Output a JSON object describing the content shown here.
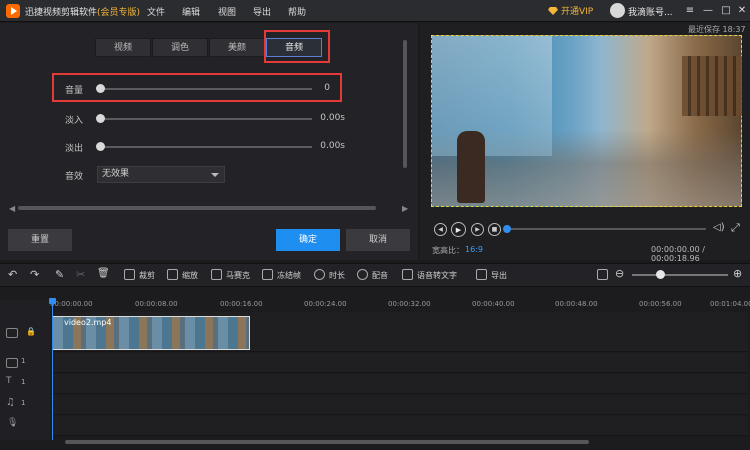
{
  "app": {
    "title": "迅捷视频剪辑软件",
    "edition": "(会员专版)"
  },
  "menu": [
    "文件",
    "编辑",
    "视图",
    "导出",
    "帮助"
  ],
  "account": {
    "vip_label": "开通VIP",
    "name": "我滴账号..."
  },
  "panel": {
    "tabs": [
      {
        "label": "视频",
        "active": false
      },
      {
        "label": "调色",
        "active": false
      },
      {
        "label": "美颜",
        "active": false
      },
      {
        "label": "音频",
        "active": true
      }
    ],
    "volume": {
      "label": "音量",
      "value": "0",
      "level": 0
    },
    "fade_in": {
      "label": "淡入",
      "value": "0.00s",
      "level": 0
    },
    "fade_out": {
      "label": "淡出",
      "value": "0.00s",
      "level": 0
    },
    "sound_effect": {
      "label": "音效",
      "value": "无效果"
    },
    "reset_label": "重置",
    "ok_label": "确定",
    "cancel_label": "取消"
  },
  "preview": {
    "autosave": "最近保存 18:37",
    "ratio_label": "宽高比：",
    "ratio_value": "16:9",
    "timecode": "00:00:00.00 / 00:00:18.96"
  },
  "toolbar": {
    "tools": [
      "裁剪",
      "缩放",
      "马赛克",
      "冻结帧",
      "时长",
      "配音",
      "语音转文字",
      "导出"
    ]
  },
  "timeline": {
    "ticks": [
      "00:00:00.00",
      "00:00:08.00",
      "00:00:16.00",
      "00:00:24.00",
      "00:00:32.00",
      "00:00:40.00",
      "00:00:48.00",
      "00:00:56.00",
      "00:01:04.00"
    ],
    "clip_name": "video2.mp4",
    "track_counts": [
      "1",
      "1",
      "1"
    ]
  },
  "colors": {
    "accent": "#1f8ef1",
    "vip": "#f3b73a",
    "highlight": "#e43a3a"
  }
}
